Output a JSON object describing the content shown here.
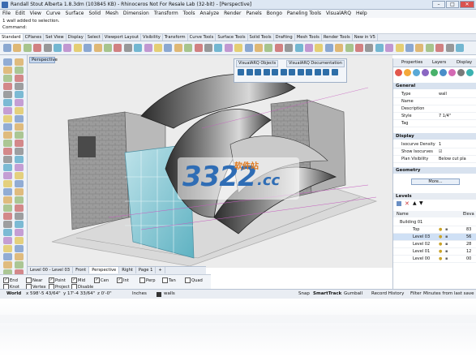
{
  "window": {
    "title": "Randall Stout Alberta 1.8.3dm (103845 KB) - Rhinoceros Not For Resale Lab (32-bit) - [Perspective]"
  },
  "menu": [
    "File",
    "Edit",
    "View",
    "Curve",
    "Surface",
    "Solid",
    "Mesh",
    "Dimension",
    "Transform",
    "Tools",
    "Analyze",
    "Render",
    "Panels",
    "Bongo",
    "Paneling Tools",
    "VisualARQ",
    "Help"
  ],
  "command_history": "1 wall added to selection.",
  "command_prompt": "Command:",
  "toolbar_tabs": [
    "Standard",
    "CPlanes",
    "Set View",
    "Display",
    "Select",
    "Viewport Layout",
    "Visibility",
    "Transform",
    "Curve Tools",
    "Surface Tools",
    "Solid Tools",
    "Drafting",
    "Mesh Tools",
    "Render Tools",
    "New in V5"
  ],
  "viewport": {
    "label": "Perspective",
    "floating_panel_tabs": [
      "VisualARQ Objects",
      "VisualARQ Documentation"
    ]
  },
  "properties": {
    "tabs": [
      "Properties",
      "Layers",
      "Display"
    ],
    "general_header": "General",
    "rows": [
      {
        "key": "Type",
        "value": "wall"
      },
      {
        "key": "Name",
        "value": ""
      },
      {
        "key": "Description",
        "value": ""
      },
      {
        "key": "Style",
        "value": "7 1/4\""
      },
      {
        "key": "Tag",
        "value": ""
      }
    ],
    "display_header": "Display",
    "display_rows": [
      {
        "key": "Isocurve Density",
        "value": "1"
      },
      {
        "key": "Show Isocurves",
        "value": "☑"
      },
      {
        "key": "Plan Visibility",
        "value": "Below cut pla"
      }
    ],
    "geometry_header": "Geometry",
    "more_button": "More..."
  },
  "layers": {
    "title": "Levels",
    "col_name": "Name",
    "col_elev": "Eleva",
    "rows": [
      {
        "name": "Building 01",
        "indent": 0
      },
      {
        "name": "Top",
        "elev": "83"
      },
      {
        "name": "Level 03",
        "elev": "56"
      },
      {
        "name": "Level 02",
        "elev": "28"
      },
      {
        "name": "Level 01",
        "elev": "12"
      },
      {
        "name": "Level 00",
        "elev": "00"
      }
    ]
  },
  "viewport_tabs": [
    "Level 00 - Level 03",
    "Front",
    "Perspective",
    "Right",
    "Page 1"
  ],
  "osnaps": [
    "End",
    "Near",
    "Point",
    "Mid",
    "Cen",
    "Int",
    "Perp",
    "Tan",
    "Quad",
    "Knot",
    "Vertex",
    "Project",
    "Disable"
  ],
  "osnap_checked": [
    "End",
    "Point",
    "Mid",
    "Cen",
    "Int"
  ],
  "status": {
    "cplane": "World",
    "x": "x 598'-5 43/64\"",
    "y": "y 17'-4 33/64\"",
    "z": "z 0'-0\"",
    "units": "Inches",
    "layer": "walls",
    "snap": "Snap",
    "smarttrack": "SmartTrack",
    "gumball": "Gumball",
    "record": "Record History",
    "filter": "Filter",
    "autosave": "Minutes from last save"
  },
  "watermark": {
    "text": "3322",
    "suffix": ".cc",
    "cn": "软件站"
  },
  "colors": {
    "accent": "#3a6ab0",
    "panel": "#eef2f7",
    "viewport_bg": "#ececec"
  }
}
